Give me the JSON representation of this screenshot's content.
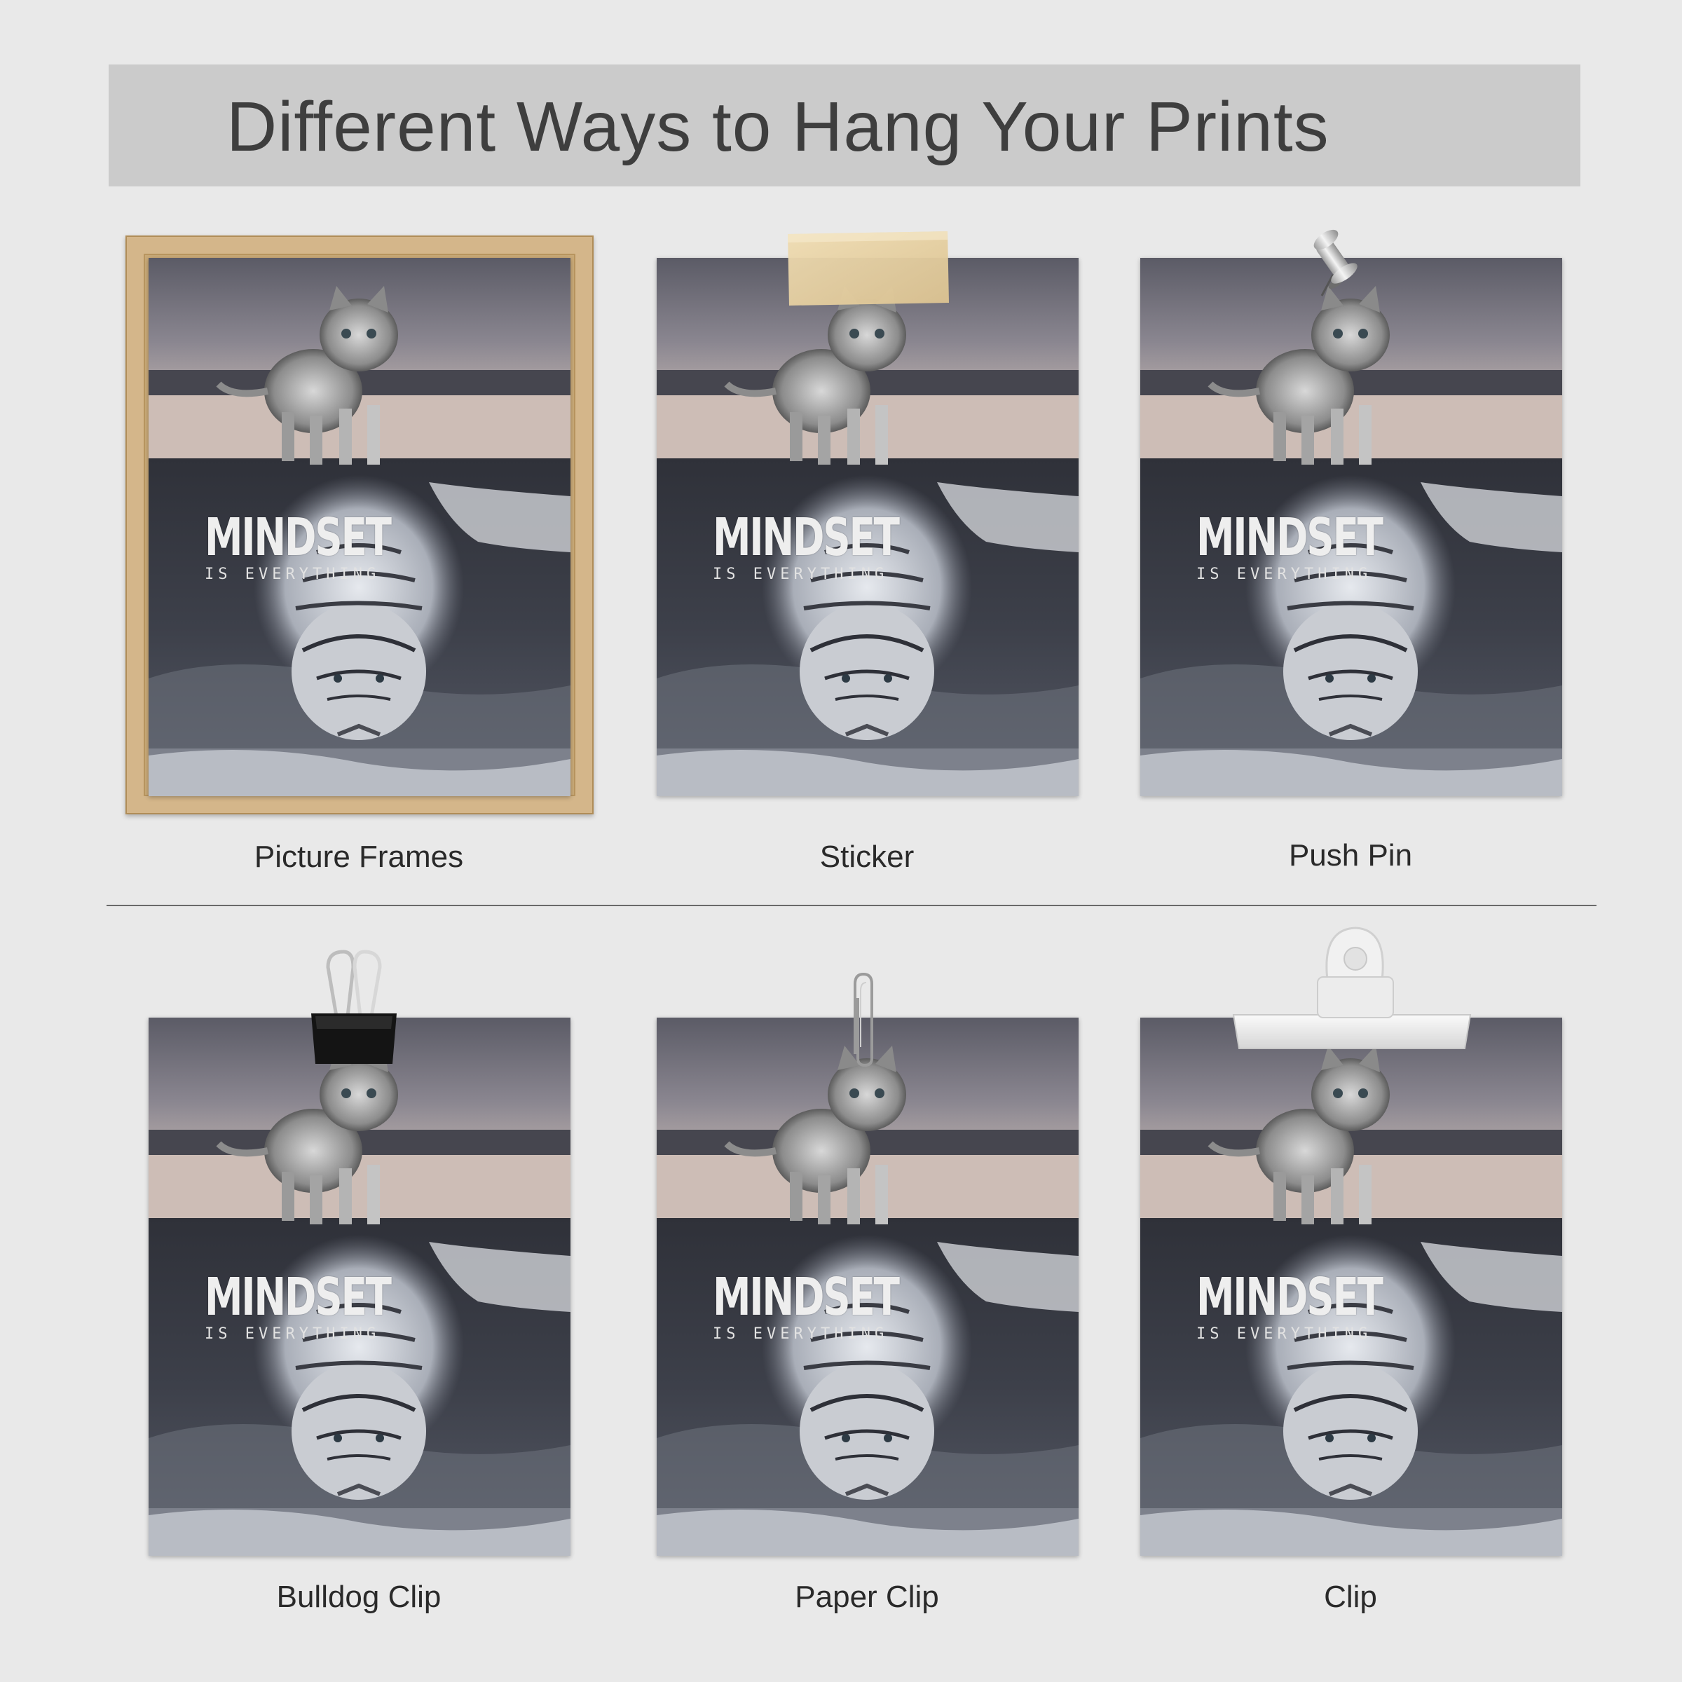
{
  "title": "Different Ways to Hang Your Prints",
  "print": {
    "main_text": "MINDSET",
    "sub_text": "IS EVERYTHING"
  },
  "methods": [
    {
      "label": "Picture Frames",
      "hanger": "wood-frame"
    },
    {
      "label": "Sticker",
      "hanger": "tape-strip"
    },
    {
      "label": "Push Pin",
      "hanger": "push-pin"
    },
    {
      "label": "Bulldog Clip",
      "hanger": "binder-clip"
    },
    {
      "label": "Paper Clip",
      "hanger": "paper-clip"
    },
    {
      "label": "Clip",
      "hanger": "plastic-clip"
    }
  ],
  "colors": {
    "background": "#e9e9e9",
    "banner": "#cbcbcb",
    "title_text": "#3e3e3e",
    "frame_wood": "#d4b68a",
    "tape": "#e8d4a6"
  }
}
